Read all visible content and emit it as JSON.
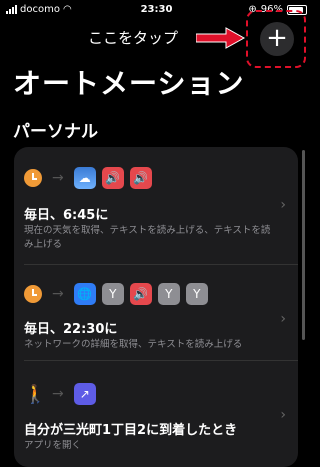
{
  "status_bar": {
    "carrier": "docomo",
    "time": "23:30",
    "battery": "96%",
    "battery_level": 0.96
  },
  "annotation": {
    "text": "ここをタップ"
  },
  "header": {
    "add_label": "+"
  },
  "page": {
    "title": "オートメーション",
    "section": "パーソナル"
  },
  "automations": [
    {
      "title": "毎日、6:45に",
      "description": "現在の天気を取得、テキストを読み上げる、テキストを読み上げる",
      "trigger_icon": "clock-icon",
      "action_icons": [
        "weather-icon",
        "speaker-icon",
        "speaker-icon"
      ]
    },
    {
      "title": "毎日、22:30に",
      "description": "ネットワークの詳細を取得、テキストを読み上げる",
      "trigger_icon": "clock-icon",
      "action_icons": [
        "globe-icon",
        "fork-icon",
        "speaker-icon",
        "fork-icon",
        "fork-icon"
      ]
    },
    {
      "title": "自分が三光町1丁目2に到着したとき",
      "description": "アプリを開く",
      "trigger_icon": "walking-person-icon",
      "action_icons": [
        "open-app-arrow-icon"
      ]
    }
  ],
  "colors": {
    "accent_red": "#e0102a",
    "clock_orange": "#f09a37",
    "card_bg": "#1c1c1e"
  }
}
